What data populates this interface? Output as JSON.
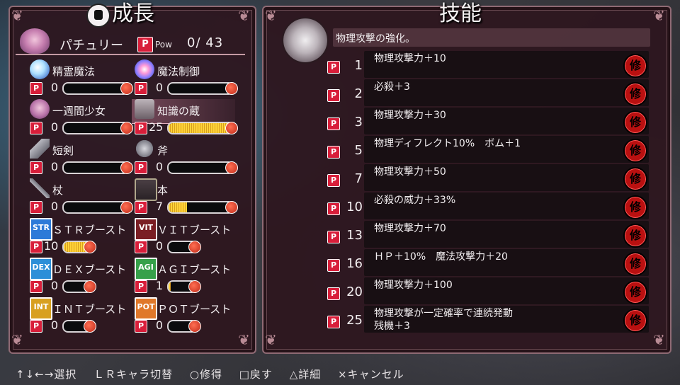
{
  "left_panel": {
    "title": "成長"
  },
  "right_panel": {
    "title": "技能"
  },
  "character": {
    "name": "パチュリー",
    "pow_badge": "P",
    "pow_label": "Pow",
    "pow_value": "0/ 43"
  },
  "skills": [
    {
      "name": "精霊魔法",
      "level": "0",
      "fill": 0,
      "icon": "spirit-icon"
    },
    {
      "name": "魔法制御",
      "level": "0",
      "fill": 0,
      "icon": "magic-orb-icon"
    },
    {
      "name": "一週間少女",
      "level": "0",
      "fill": 0,
      "icon": "girl-portrait-icon"
    },
    {
      "name": "知識の蔵",
      "level": "25",
      "fill": 1.0,
      "icon": "stone-shrine-icon"
    },
    {
      "name": "短剣",
      "level": "0",
      "fill": 0,
      "icon": "dagger-icon"
    },
    {
      "name": "斧",
      "level": "0",
      "fill": 0,
      "icon": "axe-icon"
    },
    {
      "name": "杖",
      "level": "0",
      "fill": 0,
      "icon": "staff-icon"
    },
    {
      "name": "本",
      "level": "7",
      "fill": 0.3,
      "icon": "book-icon"
    },
    {
      "name": "ＳＴＲブースト",
      "level": "10",
      "fill": 0.95,
      "icon": "str-icon",
      "icon_text": "STR"
    },
    {
      "name": "ＶＩＴブースト",
      "level": "0",
      "fill": 0,
      "icon": "vit-icon",
      "icon_text": "VIT"
    },
    {
      "name": "ＤＥＸブースト",
      "level": "0",
      "fill": 0,
      "icon": "dex-icon",
      "icon_text": "DEX"
    },
    {
      "name": "ＡＧＩブースト",
      "level": "1",
      "fill": 0.1,
      "icon": "agi-icon",
      "icon_text": "AGI"
    },
    {
      "name": "ＩＮＴブースト",
      "level": "0",
      "fill": 0,
      "icon": "int-icon",
      "icon_text": "INT"
    },
    {
      "name": "ＰＯＴブースト",
      "level": "0",
      "fill": 0,
      "icon": "pot-icon",
      "icon_text": "POT"
    }
  ],
  "detail": {
    "description": "物理攻撃の強化。"
  },
  "perks": [
    {
      "level": "1",
      "text": "物理攻撃力＋10"
    },
    {
      "level": "2",
      "text": "必殺＋3"
    },
    {
      "level": "3",
      "text": "物理攻撃力＋30"
    },
    {
      "level": "5",
      "text": "物理ディフレクト10%　ボム＋1"
    },
    {
      "level": "7",
      "text": "物理攻撃力＋50"
    },
    {
      "level": "10",
      "text": "必殺の威力＋33%"
    },
    {
      "level": "13",
      "text": "物理攻撃力＋70"
    },
    {
      "level": "16",
      "text": "ＨＰ＋10%　魔法攻撃力＋20"
    },
    {
      "level": "20",
      "text": "物理攻撃力＋100"
    },
    {
      "level": "25",
      "text": "物理攻撃が一定確率で連続発動\n残機＋3"
    }
  ],
  "seal_char": "修",
  "p_badge": "P",
  "footer": {
    "select": "↑↓←→選択",
    "switch": "ＬＲキャラ切替",
    "learn": "○修得",
    "back": "□戻す",
    "detail": "△詳細",
    "cancel": "×キャンセル"
  }
}
